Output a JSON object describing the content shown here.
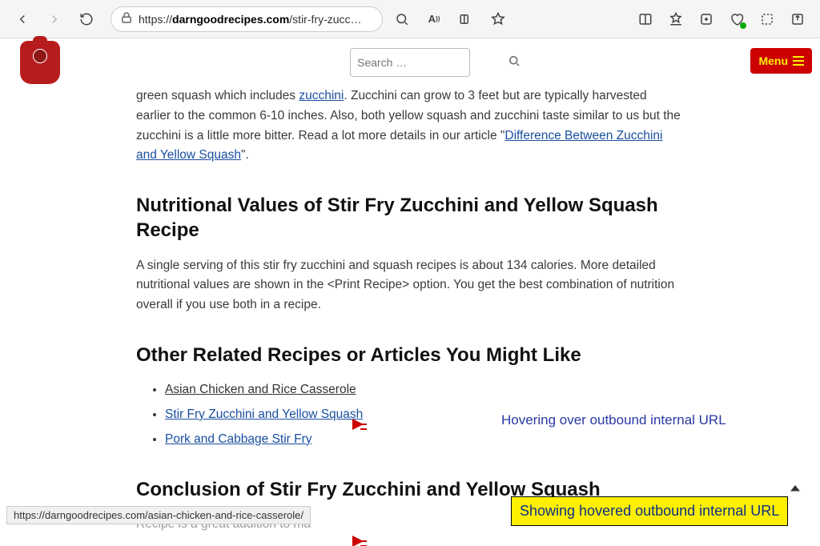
{
  "browser": {
    "url_prefix": "https://",
    "url_domain": "darngoodrecipes.com",
    "url_path": "/stir-fry-zucc…",
    "status_url": "https://darngoodrecipes.com/asian-chicken-and-rice-casserole/"
  },
  "header": {
    "search_placeholder": "Search …",
    "menu_label": "Menu"
  },
  "article": {
    "intro_pre": "green squash which includes ",
    "intro_link1": "zucchini",
    "intro_mid": ". Zucchini can grow to 3 feet but are typically harvested earlier to the common 6-10 inches. Also, both yellow squash and zucchini taste similar to us but the zucchini is a little more bitter. Read a lot more details in our article \"",
    "intro_link2": "Difference Between Zucchini and Yellow Squash",
    "intro_post": "\".",
    "h2_nutrition": "Nutritional Values of Stir Fry Zucchini and Yellow Squash Recipe",
    "nutrition_p": "A single serving of this stir fry zucchini and squash recipes is about 134 calories. More detailed nutritional values are shown in the <Print Recipe> option. You get the best combination of nutrition overall if you use both in a recipe.",
    "h2_related": "Other Related Recipes or Articles You Might Like",
    "related": [
      "Asian Chicken and Rice Casserole",
      "Stir Fry Zucchini and Yellow Squash",
      "Pork and Cabbage Stir Fry"
    ],
    "h2_conclusion": "Conclusion of Stir Fry Zucchini and Yellow Squash",
    "conclusion_partial": "Recipe is a great addition to ma"
  },
  "annotations": {
    "hover_label": "Hovering over outbound internal URL",
    "status_label": "Showing hovered outbound internal URL"
  }
}
